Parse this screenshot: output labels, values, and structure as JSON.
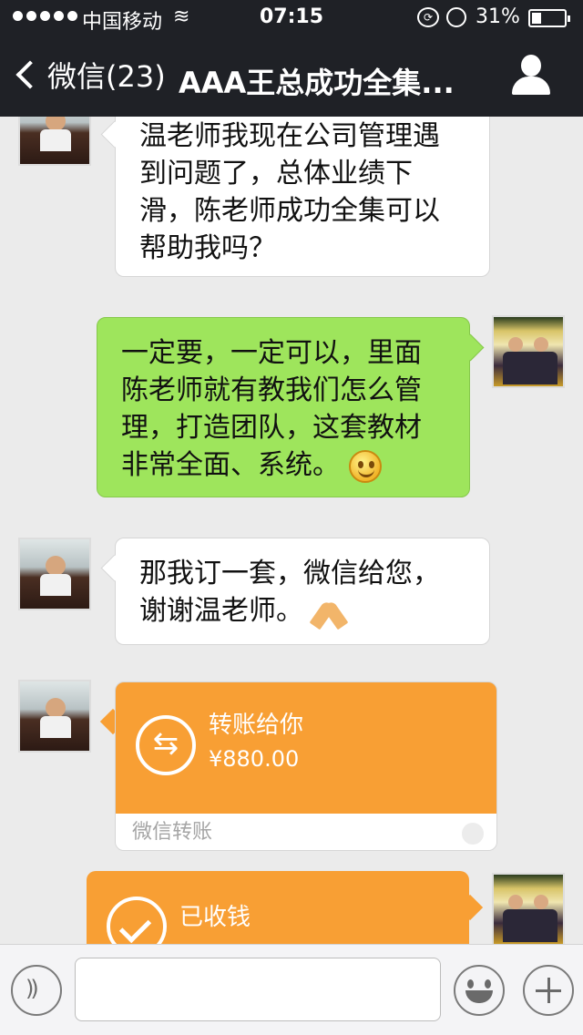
{
  "status_bar": {
    "carrier": "中国移动",
    "time": "07:15",
    "battery": "31%"
  },
  "nav": {
    "back_label": "微信(23)",
    "title": "AAA王总成功全集..."
  },
  "messages": [
    {
      "side": "in",
      "text": "温老师我现在公司管理遇到问题了，总体业绩下滑，陈老师成功全集可以帮助我吗？"
    },
    {
      "side": "out",
      "text": "一定要，一定可以，里面陈老师就有教我们怎么管理，打造团队，这套教材非常全面、系统。",
      "emoji": "smile-emoji"
    },
    {
      "side": "in",
      "text": "那我订一套，微信给您，谢谢温老师。",
      "emoji": "pray-hands-emoji"
    }
  ],
  "transfer": {
    "label": "转账给你",
    "amount": "¥880.00",
    "footer": "微信转账"
  },
  "received": {
    "label": "已收钱"
  },
  "input_bar": {
    "value": ""
  }
}
